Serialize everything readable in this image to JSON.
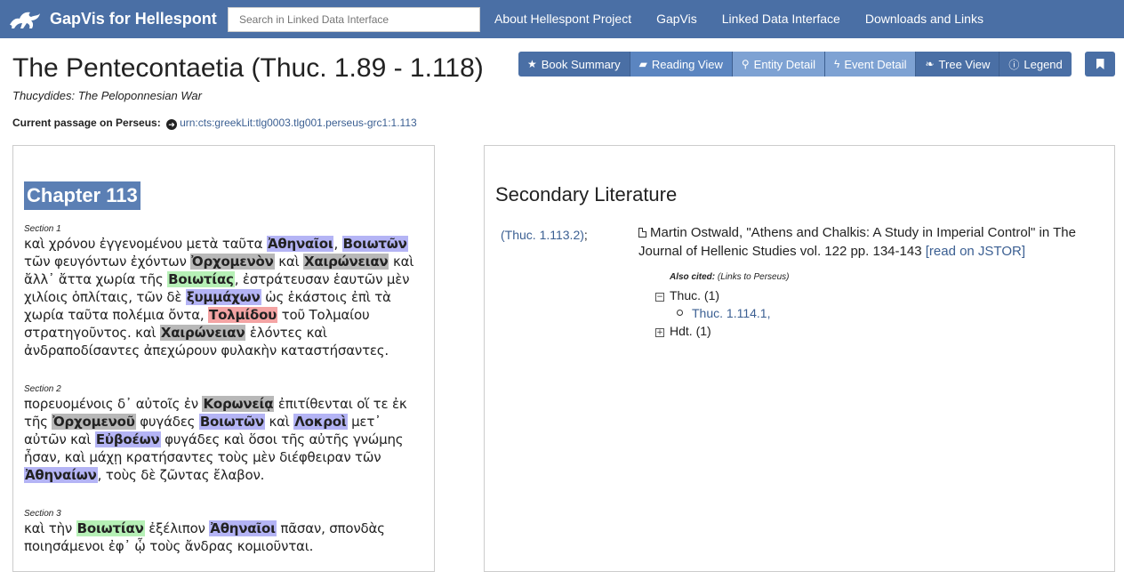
{
  "navbar": {
    "brand": "GapVis for Hellespont",
    "search_placeholder": "Search in Linked Data Interface",
    "links": [
      "About Hellespont Project",
      "GapVis",
      "Linked Data Interface",
      "Downloads and Links"
    ]
  },
  "header": {
    "title": "The Pentecontaetia (Thuc. 1.89 - 1.118)",
    "subtitle": "Thucydides: The Peloponnesian War",
    "current_passage_label": "Current passage on Perseus:",
    "current_passage_urn": "urn:cts:greekLit:tlg0003.tlg001.perseus-grc1:1.113"
  },
  "view_buttons": [
    {
      "label": "Book Summary",
      "icon": "star-icon"
    },
    {
      "label": "Reading View",
      "icon": "book-icon"
    },
    {
      "label": "Entity Detail",
      "icon": "map-marker-icon"
    },
    {
      "label": "Event Detail",
      "icon": "bolt-icon"
    },
    {
      "label": "Tree View",
      "icon": "leaf-icon"
    },
    {
      "label": "Legend",
      "icon": "info-icon"
    }
  ],
  "reading": {
    "chapter_title": "Chapter 113",
    "sections": [
      {
        "label": "Section 1",
        "segments": [
          [
            "καὶ χρόνου ἐγγενομένου μετὰ ταῦτα ",
            ""
          ],
          [
            "Ἀθηναῖοι",
            "p"
          ],
          [
            ", ",
            ""
          ],
          [
            "Βοιωτῶν",
            "p"
          ],
          [
            " τῶν φευγόντων ἐχόντων ",
            ""
          ],
          [
            "Ὀρχομενὸν",
            "g"
          ],
          [
            " καὶ ",
            ""
          ],
          [
            "Χαιρώνειαν",
            "g"
          ],
          [
            " καὶ ἄλλ᾽ ἄττα χωρία τῆς ",
            ""
          ],
          [
            "Βοιωτίας",
            "gr"
          ],
          [
            ", ἐστράτευσαν ἑαυτῶν μὲν χιλίοις ὁπλίταις, τῶν δὲ ",
            ""
          ],
          [
            "ξυμμάχων",
            "p"
          ],
          [
            " ὡς ἑκάστοις ἐπὶ τὰ χωρία ταῦτα πολέμια ὄντα, ",
            ""
          ],
          [
            "Τολμίδου",
            "r"
          ],
          [
            " τοῦ Τολμαίου στρατηγοῦντος. καὶ ",
            ""
          ],
          [
            "Χαιρώνειαν",
            "g"
          ],
          [
            " ἑλόντες καὶ ἀνδραποδίσαντες ἀπεχώρουν φυλακὴν καταστήσαντες.",
            ""
          ]
        ]
      },
      {
        "label": "Section 2",
        "segments": [
          [
            "πορευομένοις δ᾽ αὐτοῖς ἐν ",
            ""
          ],
          [
            "Κορωνείᾳ",
            "g"
          ],
          [
            " ἐπιτίθενται οἵ τε ἐκ τῆς ",
            ""
          ],
          [
            "Ὀρχομενοῦ",
            "g"
          ],
          [
            " φυγάδες ",
            ""
          ],
          [
            "Βοιωτῶν",
            "p"
          ],
          [
            " καὶ ",
            ""
          ],
          [
            "Λοκροὶ",
            "p"
          ],
          [
            " μετ᾽ αὐτῶν καὶ ",
            ""
          ],
          [
            "Εὐβοέων",
            "p"
          ],
          [
            " φυγάδες καὶ ὅσοι τῆς αὐτῆς γνώμης ἦσαν, καὶ μάχῃ κρατήσαντες τοὺς μὲν διέφθειραν τῶν ",
            ""
          ],
          [
            "Ἀθηναίων",
            "p"
          ],
          [
            ", τοὺς δὲ ζῶντας ἔλαβον.",
            ""
          ]
        ]
      },
      {
        "label": "Section 3",
        "segments": [
          [
            "καὶ τὴν ",
            ""
          ],
          [
            "Βοιωτίαν",
            "gr"
          ],
          [
            " ἐξέλιπον ",
            ""
          ],
          [
            "Ἀθηναῖοι",
            "p"
          ],
          [
            " πᾶσαν, σπονδὰς ποιησάμενοι ἐφ᾽ ᾧ τοὺς ἄνδρας κομιοῦνται.",
            ""
          ]
        ]
      }
    ]
  },
  "secondary": {
    "title": "Secondary Literature",
    "ref": "(Thuc. 1.113.2)",
    "ref_suffix": ";",
    "entry_text": "Martin Ostwald, \"Athens and Chalkis: A Study in Imperial Control\" in The Journal of Hellenic Studies vol. 122 pp. 134-143",
    "entry_link": "[read on JSTOR]",
    "also_cited_label": "Also cited:",
    "also_cited_note": "(Links to Perseus)",
    "cited": [
      {
        "toggle": "−",
        "label": "Thuc. (1)",
        "children": [
          "Thuc. 1.114.1,"
        ]
      },
      {
        "toggle": "+",
        "label": "Hdt. (1)",
        "children": []
      }
    ]
  },
  "colors": {
    "navbar": "#4a6fa5",
    "highlight_people": "#b4b4f5",
    "highlight_place": "#b8b8b8",
    "highlight_region": "#b6f0b6",
    "highlight_person_alt": "#f4a4a4"
  }
}
